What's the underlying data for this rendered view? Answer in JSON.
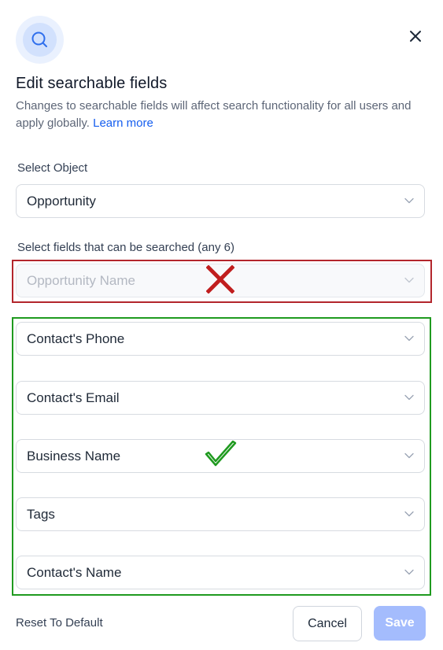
{
  "dialog": {
    "icon": "search-icon",
    "close_icon": "close-icon",
    "title": "Edit searchable fields",
    "description": "Changes to searchable fields will affect search functionality for all users and apply globally.",
    "learn_more": "Learn more"
  },
  "object_select": {
    "label": "Select Object",
    "value": "Opportunity"
  },
  "fields": {
    "label": "Select fields that can be searched (any 6)",
    "items": [
      {
        "value": "Opportunity Name",
        "disabled": true
      },
      {
        "value": "Contact's Phone",
        "disabled": false
      },
      {
        "value": "Contact's Email",
        "disabled": false
      },
      {
        "value": "Business Name",
        "disabled": false
      },
      {
        "value": "Tags",
        "disabled": false
      },
      {
        "value": "Contact's Name",
        "disabled": false
      }
    ]
  },
  "annotations": {
    "cross_icon": "red-cross-icon",
    "check_icon": "green-checkmark-icon",
    "cross_color": "#c01e1e",
    "check_color": "#1f9a1f"
  },
  "footer": {
    "reset_label": "Reset To Default",
    "cancel_label": "Cancel",
    "save_label": "Save"
  },
  "colors": {
    "accent": "#155eef",
    "save_disabled": "#a4bcfd"
  }
}
